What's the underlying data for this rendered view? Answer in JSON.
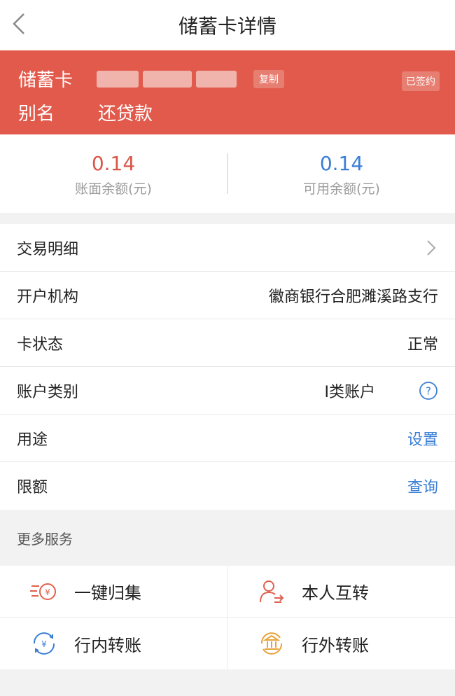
{
  "header": {
    "title": "储蓄卡详情"
  },
  "card": {
    "type_label": "储蓄卡",
    "copy_label": "复制",
    "signed_badge": "已签约",
    "alias_label": "别名",
    "alias_value": "还贷款",
    "bg_color": "#e15a4b"
  },
  "balances": {
    "book": {
      "value": "0.14",
      "label": "账面余额(元)"
    },
    "available": {
      "value": "0.14",
      "label": "可用余额(元)"
    }
  },
  "details": {
    "transactions": {
      "label": "交易明细"
    },
    "bank": {
      "label": "开户机构",
      "value": "徽商银行合肥濉溪路支行"
    },
    "status": {
      "label": "卡状态",
      "value": "正常"
    },
    "account_type": {
      "label": "账户类别",
      "value": "I类账户"
    },
    "purpose": {
      "label": "用途",
      "action": "设置"
    },
    "limit": {
      "label": "限额",
      "action": "查询"
    }
  },
  "more_services": {
    "heading": "更多服务",
    "items": [
      {
        "label": "一键归集",
        "icon": "collect-funds-icon"
      },
      {
        "label": "本人互转",
        "icon": "self-transfer-icon"
      },
      {
        "label": "行内转账",
        "icon": "intra-bank-transfer-icon"
      },
      {
        "label": "行外转账",
        "icon": "inter-bank-transfer-icon"
      }
    ]
  },
  "colors": {
    "accent_blue": "#3a7ed6",
    "accent_red": "#d9574a",
    "icon_orange": "#e8a33a"
  }
}
